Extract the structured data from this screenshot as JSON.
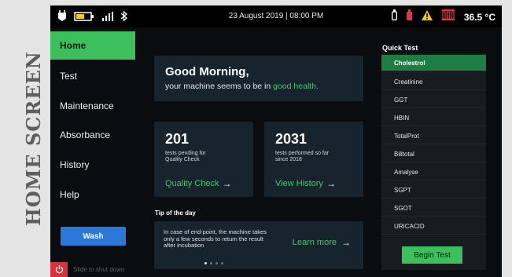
{
  "caption": "HOME SCREEN",
  "status_bar": {
    "datetime": "23 August 2019 | 08:00 PM",
    "temperature": "36.5 °C",
    "icons": [
      "charging-icon",
      "battery-icon",
      "signal-icon",
      "bluetooth-icon",
      "bottle-icon",
      "reagent-bottle-icon",
      "warning-icon",
      "cuvette-rack-icon"
    ]
  },
  "sidebar": {
    "items": [
      {
        "label": "Home",
        "active": true
      },
      {
        "label": "Test"
      },
      {
        "label": "Maintenance"
      },
      {
        "label": "Absorbance"
      },
      {
        "label": "History"
      },
      {
        "label": "Help"
      }
    ],
    "wash_label": "Wash",
    "shutdown_label": "Slide to shut down"
  },
  "greeting": {
    "title": "Good Morning,",
    "line_prefix": "your machine seems to be in",
    "line_highlight": "good health."
  },
  "stats": [
    {
      "number": "201",
      "desc_line1": "tests pending for",
      "desc_line2": "Quality Check",
      "link": "Quality Check"
    },
    {
      "number": "2031",
      "desc_line1": "tests performed so far",
      "desc_line2": "since 2018",
      "link": "View History"
    }
  ],
  "tip": {
    "title": "Tip of the day",
    "text": "In case of end-point, the machine takes only a few seconds to return the result after incubation",
    "link": "Learn more",
    "page_count": 4,
    "current_page": 1
  },
  "quick_test": {
    "title": "Quick Test",
    "items": [
      "Cholestrol",
      "Creatinine",
      "GGT",
      "HBIN",
      "TotalProt",
      "Billtotal",
      "Amalyse",
      "SGPT",
      "SGOT",
      "URICACID"
    ],
    "selected": "Cholestrol",
    "begin_label": "Begin Test"
  },
  "colors": {
    "accent_green": "#3dbf5d",
    "link_green": "#42c968",
    "selected_green": "#1e7d44",
    "wash_blue": "#2c78d8",
    "power_red": "#d8323e",
    "card_bg": "#17242e",
    "warning_yellow": "#f5c518"
  }
}
